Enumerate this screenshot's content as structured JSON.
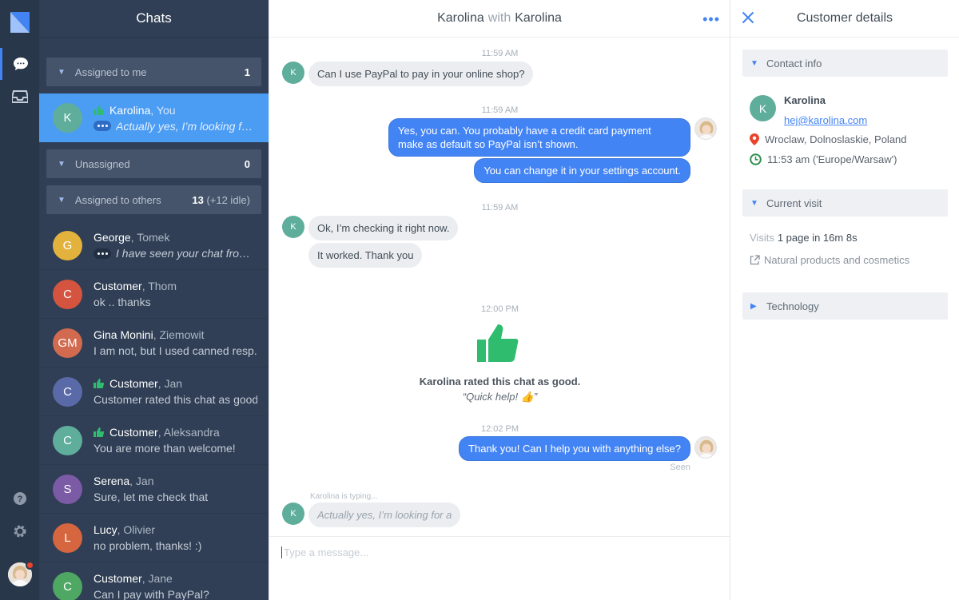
{
  "colors": {
    "rail": "#28374a",
    "list": "#303f55",
    "selected": "#4b9cf3",
    "accent": "#4384f5",
    "thumb": "#2fbc6e"
  },
  "rail": {
    "icons": [
      "chat-icon",
      "inbox-icon",
      "help-icon",
      "settings-icon"
    ]
  },
  "chats": {
    "title": "Chats",
    "groups": [
      {
        "label": "Assigned to me",
        "count": "1",
        "idle": ""
      },
      {
        "label": "Unassigned",
        "count": "0",
        "idle": ""
      },
      {
        "label": "Assigned to others",
        "count": "13",
        "idle": "(+12 idle)"
      }
    ],
    "items": [
      {
        "initials": "K",
        "color": "#5fae9c",
        "name": "Karolina",
        "agent": ", You",
        "preview": "Actually yes, I’m looking for a",
        "typing": true,
        "rated": true
      },
      {
        "initials": "G",
        "color": "#e3b23c",
        "name": "George",
        "agent": ", Tomek",
        "preview": "I have seen your chat from ...",
        "typing": true,
        "rated": false
      },
      {
        "initials": "C",
        "color": "#d5543f",
        "name": "Customer",
        "agent": ", Thom",
        "preview": "ok .. thanks",
        "typing": false,
        "rated": false
      },
      {
        "initials": "GM",
        "color": "#d16a4f",
        "name": "Gina Monini",
        "agent": ", Ziemowit",
        "preview": "I am not, but I used canned resp...",
        "typing": false,
        "rated": false
      },
      {
        "initials": "C",
        "color": "#5a6aa8",
        "name": "Customer",
        "agent": ", Jan",
        "preview": "Customer rated this chat as good.",
        "typing": false,
        "rated": true
      },
      {
        "initials": "C",
        "color": "#5fae9c",
        "name": "Customer",
        "agent": ", Aleksandra",
        "preview": "You are more than welcome!",
        "typing": false,
        "rated": true
      },
      {
        "initials": "S",
        "color": "#7b5aa6",
        "name": "Serena",
        "agent": ", Jan",
        "preview": "Sure, let me check that",
        "typing": false,
        "rated": false
      },
      {
        "initials": "L",
        "color": "#d5663f",
        "name": "Lucy",
        "agent": ", Olivier",
        "preview": "no problem, thanks! :)",
        "typing": false,
        "rated": false
      },
      {
        "initials": "C",
        "color": "#4ea863",
        "name": "Customer",
        "agent": ", Jane",
        "preview": "Can I pay with PayPal?",
        "typing": false,
        "rated": false
      }
    ]
  },
  "conversation": {
    "customer": "Karolina",
    "with": "with",
    "agent": "Karolina",
    "more_label": "•••",
    "ts1": "11:59 AM",
    "m1": "Can I use PayPal to pay in your online shop?",
    "ts2": "11:59 AM",
    "m2a": "Yes, you can. You probably have a credit card payment",
    "m2b": "make as default so PayPal isn’t shown.",
    "m3": "You can change it in your settings account.",
    "ts3": "11:59 AM",
    "m4": "Ok, I’m checking it right now.",
    "m5": "It worked. Thank you",
    "ts4": "12:00 PM",
    "rating_text": "Karolina rated this chat as good.",
    "rating_quote": "“Quick help! 👍”",
    "ts5": "12:02 PM",
    "m6": "Thank you! Can I help you with anything else?",
    "seen": "Seen",
    "typing_label": "Karolina is typing...",
    "typing_text": "Actually yes, I’m looking for a",
    "avatar_initial": "K",
    "composer_placeholder": "Type a message..."
  },
  "details": {
    "title": "Customer details",
    "contact_section": "Contact info",
    "initial": "K",
    "name": "Karolina",
    "email": "hej@karolina.com",
    "location": "Wroclaw, Dolnoslaskie, Poland",
    "time": "11:53 am ('Europe/Warsaw')",
    "visit_section": "Current visit",
    "visits_label": "Visits",
    "visits_value": "1 page in 16m 8s",
    "page_title": "Natural products and cosmetics",
    "tech_section": "Technology"
  }
}
